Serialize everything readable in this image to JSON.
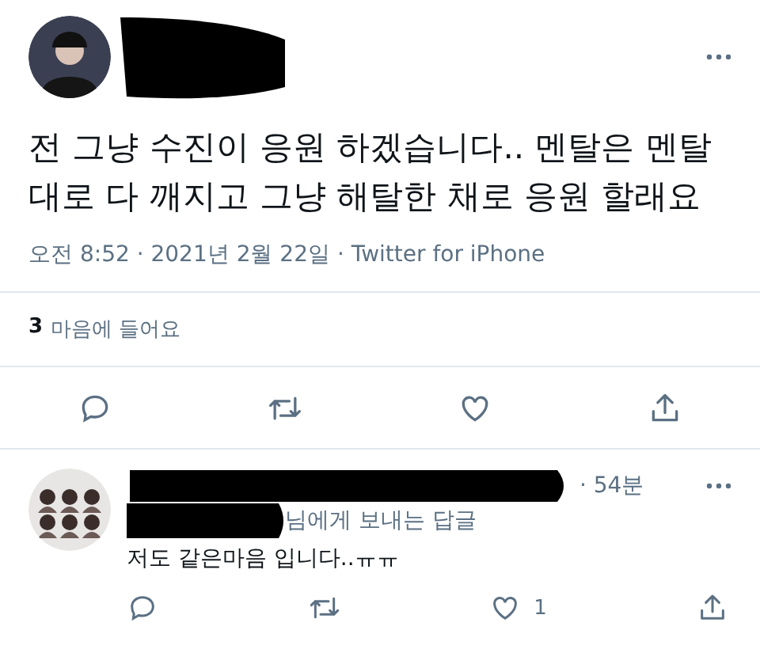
{
  "tweet": {
    "text_lines": [
      "전 그냥 수진이 응원 하겠습니다.. 멘탈은 멘탈",
      "대로 다 깨지고 그냥 해탈한 채로 응원 할래요"
    ],
    "meta": "오전 8:52 · 2021년 2월 22일 · Twitter for iPhone",
    "likes_count": "3",
    "likes_label": "마음에 들어요"
  },
  "reply": {
    "time": "· 54분",
    "reply_to": "님에게 보내는 답글",
    "text": "저도 같은마음 입니다..ㅠㅠ",
    "like_count": "1"
  }
}
